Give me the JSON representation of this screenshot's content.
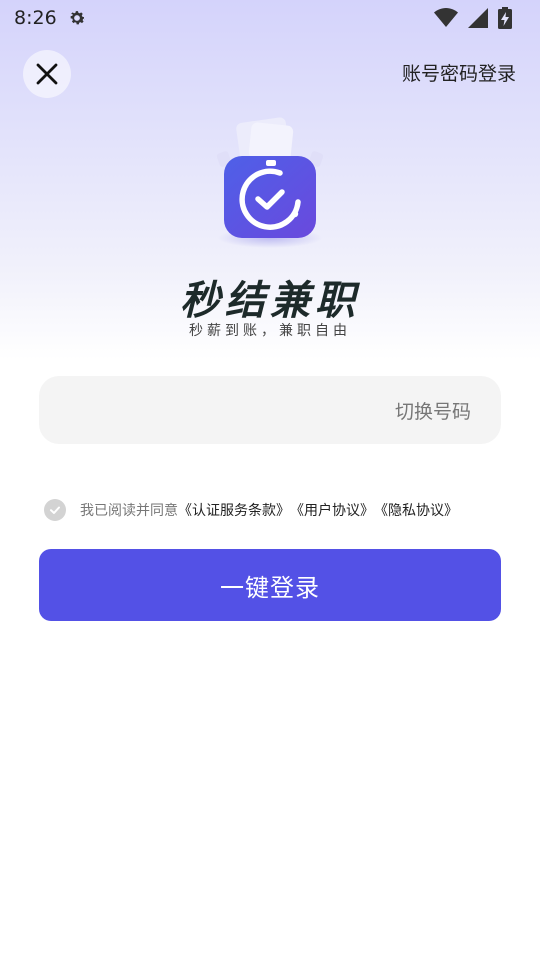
{
  "status_bar": {
    "time": "8:26",
    "icons": [
      "settings-gear-icon",
      "wifi-icon",
      "signal-icon",
      "battery-charging-icon"
    ]
  },
  "header": {
    "close_icon": "close-icon",
    "account_login_label": "账号密码登录"
  },
  "brand": {
    "logo_icon": "timer-check-icon",
    "title": "秒结兼职",
    "slogan": "秒薪到账，兼职自由"
  },
  "phone": {
    "switch_label": "切换号码"
  },
  "agreement": {
    "prefix": "我已阅读并同意",
    "links": [
      "《认证服务条款》",
      "《用户协议》",
      "《隐私协议》"
    ]
  },
  "login_button": {
    "label": "一键登录"
  },
  "colors": {
    "accent": "#5351e6",
    "background_top": "#d4d3fb",
    "input_bg": "#f4f4f4"
  }
}
